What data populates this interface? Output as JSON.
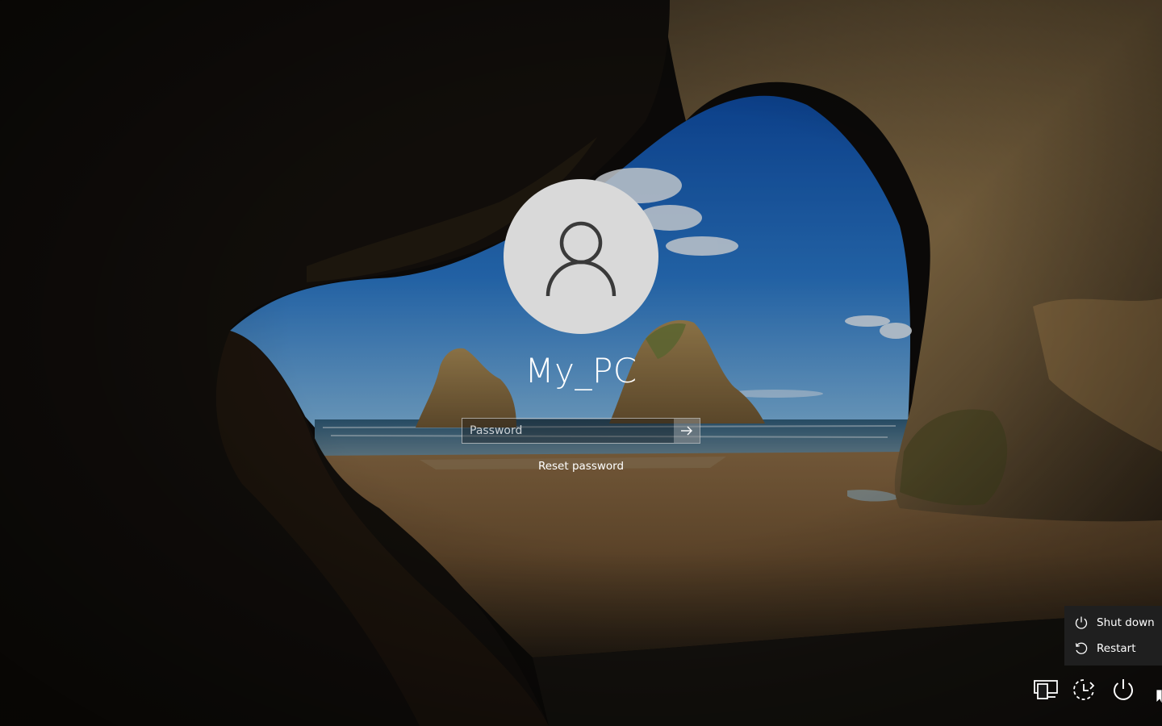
{
  "user": {
    "name": "My_PC",
    "avatar_icon": "user-silhouette-icon"
  },
  "login": {
    "password_placeholder": "Password",
    "password_value": "",
    "submit_icon": "arrow-right-icon",
    "reset_password_label": "Reset password"
  },
  "power_menu": {
    "items": [
      {
        "label": "Shut down",
        "icon": "power-icon"
      },
      {
        "label": "Restart",
        "icon": "restart-icon"
      }
    ]
  },
  "tray": {
    "network_icon": "network-icon",
    "ease_of_access_icon": "ease-of-access-icon",
    "power_icon": "power-icon"
  },
  "colors": {
    "avatar_bg": "#d9d9d9",
    "menu_bg": "#1f1f1f",
    "text": "#ffffff"
  }
}
